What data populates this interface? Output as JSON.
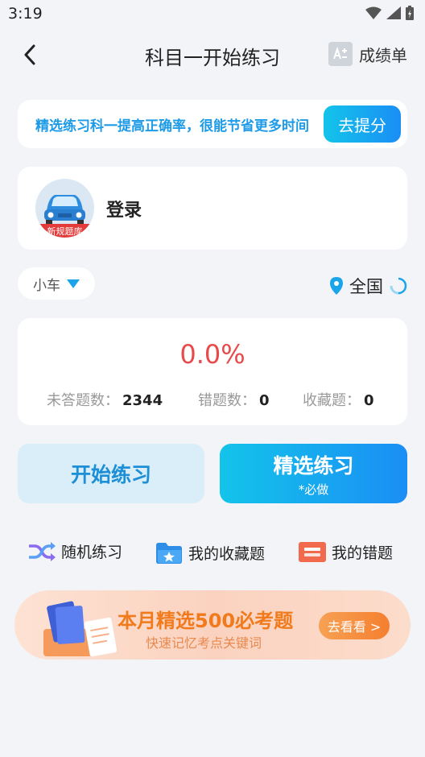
{
  "status_bar": {
    "time": "3:19"
  },
  "header": {
    "title": "科目一开始练习",
    "scores_label": "成绩单"
  },
  "banner": {
    "text": "精选练习科一提高正确率，很能节省更多时间",
    "button": "去提分"
  },
  "login": {
    "label": "登录",
    "avatar_badge": "新规题库"
  },
  "vehicle": {
    "label": "小车"
  },
  "region": {
    "label": "全国"
  },
  "stats": {
    "accuracy": "0.0%",
    "unanswered_label": "未答题数：",
    "unanswered_value": "2344",
    "wrong_label": "错题数：",
    "wrong_value": "0",
    "fav_label": "收藏题：",
    "fav_value": "0"
  },
  "actions": {
    "start_label": "开始练习",
    "selected_label": "精选练习",
    "selected_sub": "*必做"
  },
  "quick_links": {
    "random": "随机练习",
    "favorites": "我的收藏题",
    "mistakes": "我的错题"
  },
  "promo": {
    "title": "本月精选500必考题",
    "subtitle": "快速记忆考点关键词",
    "button": "去看看 >"
  },
  "colors": {
    "accent": "#1a8ef5",
    "accuracy": "#e84a4a",
    "promo": "#f07a1c"
  }
}
